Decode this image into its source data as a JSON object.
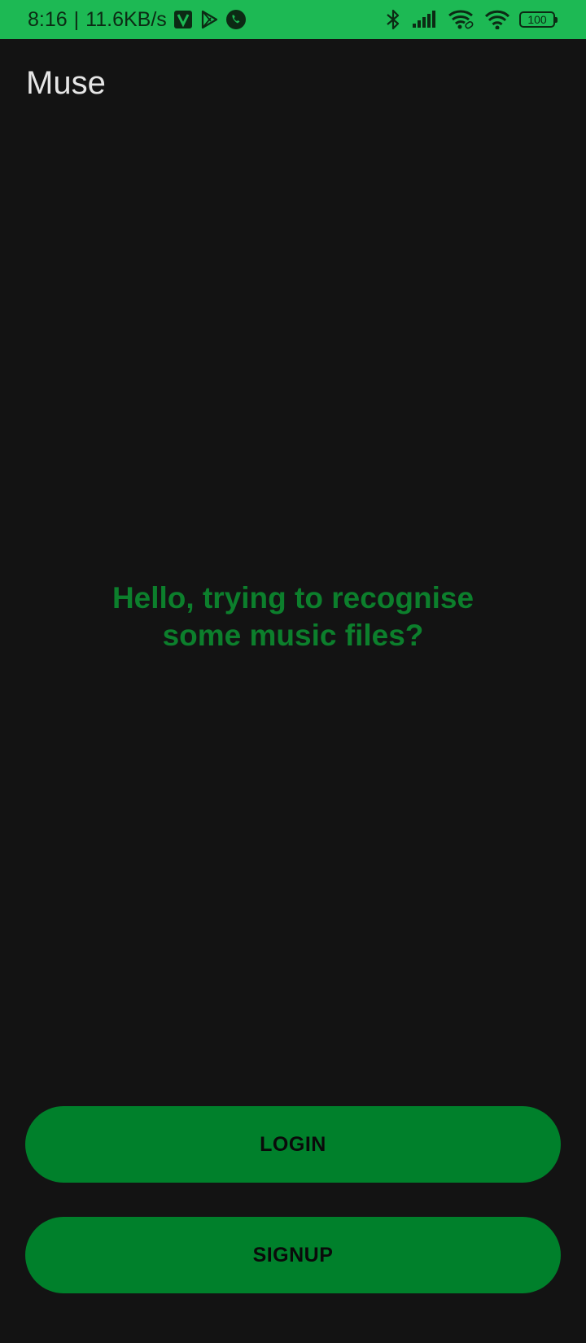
{
  "status_bar": {
    "time": "8:16",
    "separator": "|",
    "network_speed": "11.6KB/s",
    "battery_level": "100",
    "left_icons": [
      "vpn-v-icon",
      "play-store-icon",
      "phone-call-icon"
    ],
    "right_icons": [
      "bluetooth-icon",
      "signal-icon",
      "wifi-link-icon",
      "wifi-icon",
      "battery-icon"
    ],
    "background_color": "#1DB954"
  },
  "app_bar": {
    "title": "Muse"
  },
  "hero": {
    "line1": "Hello, trying to recognise",
    "line2": "some music files?",
    "color": "#0c7f2c"
  },
  "actions": {
    "login_label": "LOGIN",
    "signup_label": "SIGNUP",
    "button_color": "#00802b"
  }
}
